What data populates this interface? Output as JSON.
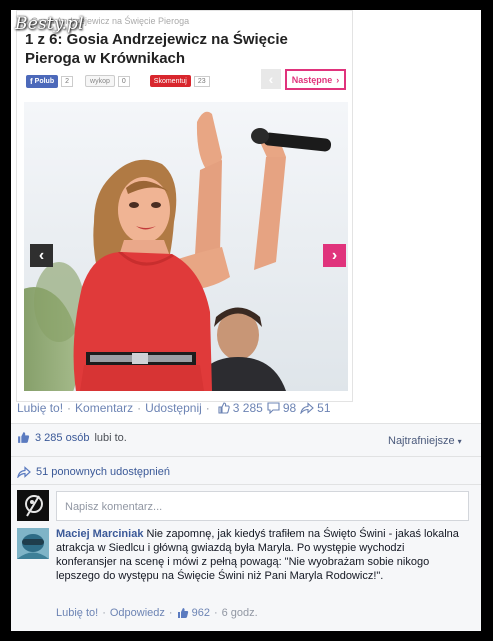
{
  "watermark": "Besty.pl",
  "article": {
    "breadcrumb": "Gosia Andrzejewicz na Święcie Pieroga",
    "title": "1 z 6: Gosia Andrzejewicz na Święcie Pieroga w Krównikach",
    "fb_like_label": "Polub",
    "fb_like_count": "2",
    "wykop_label": "wykop",
    "wykop_count": "0",
    "comment_label": "Skomentuj",
    "comment_count": "23",
    "prev_label": "‹",
    "next_label": "Następne",
    "next_arrow": "›"
  },
  "post_actions": {
    "like": "Lubię to!",
    "comment": "Komentarz",
    "share": "Udostępnij",
    "like_count": "3 285",
    "comment_count": "98",
    "share_count": "51"
  },
  "likes_summary": {
    "count_text": "3 285 osób",
    "suffix": "lubi to."
  },
  "sort_label": "Najtrafniejsze",
  "shares_summary": "51 ponownych udostępnień",
  "comment_input": {
    "placeholder": "Napisz komentarz..."
  },
  "comment": {
    "author": "Maciej Marciniak",
    "text": "Nie zapomnę, jak kiedyś trafiłem na Święto Świni - jakaś lokalna atrakcja w Siedlcu i główną gwiazdą była Maryla. Po występie wychodzi konferansjer na scenę i mówi z pełną powagą: \"Nie wyobrażam sobie nikogo lepszego do występu na Święcie Świni niż Pani Maryla Rodowicz!\".",
    "like": "Lubię to!",
    "reply": "Odpowiedz",
    "likes": "962",
    "time": "6 godz."
  },
  "icons": {
    "thumb": "thumbs-up-icon",
    "bubble": "comment-bubble-icon",
    "share": "share-arrow-icon"
  },
  "colors": {
    "facebook_blue": "#3b5998",
    "accent_pink": "#e0337c",
    "dress_red": "#e03a3a"
  }
}
